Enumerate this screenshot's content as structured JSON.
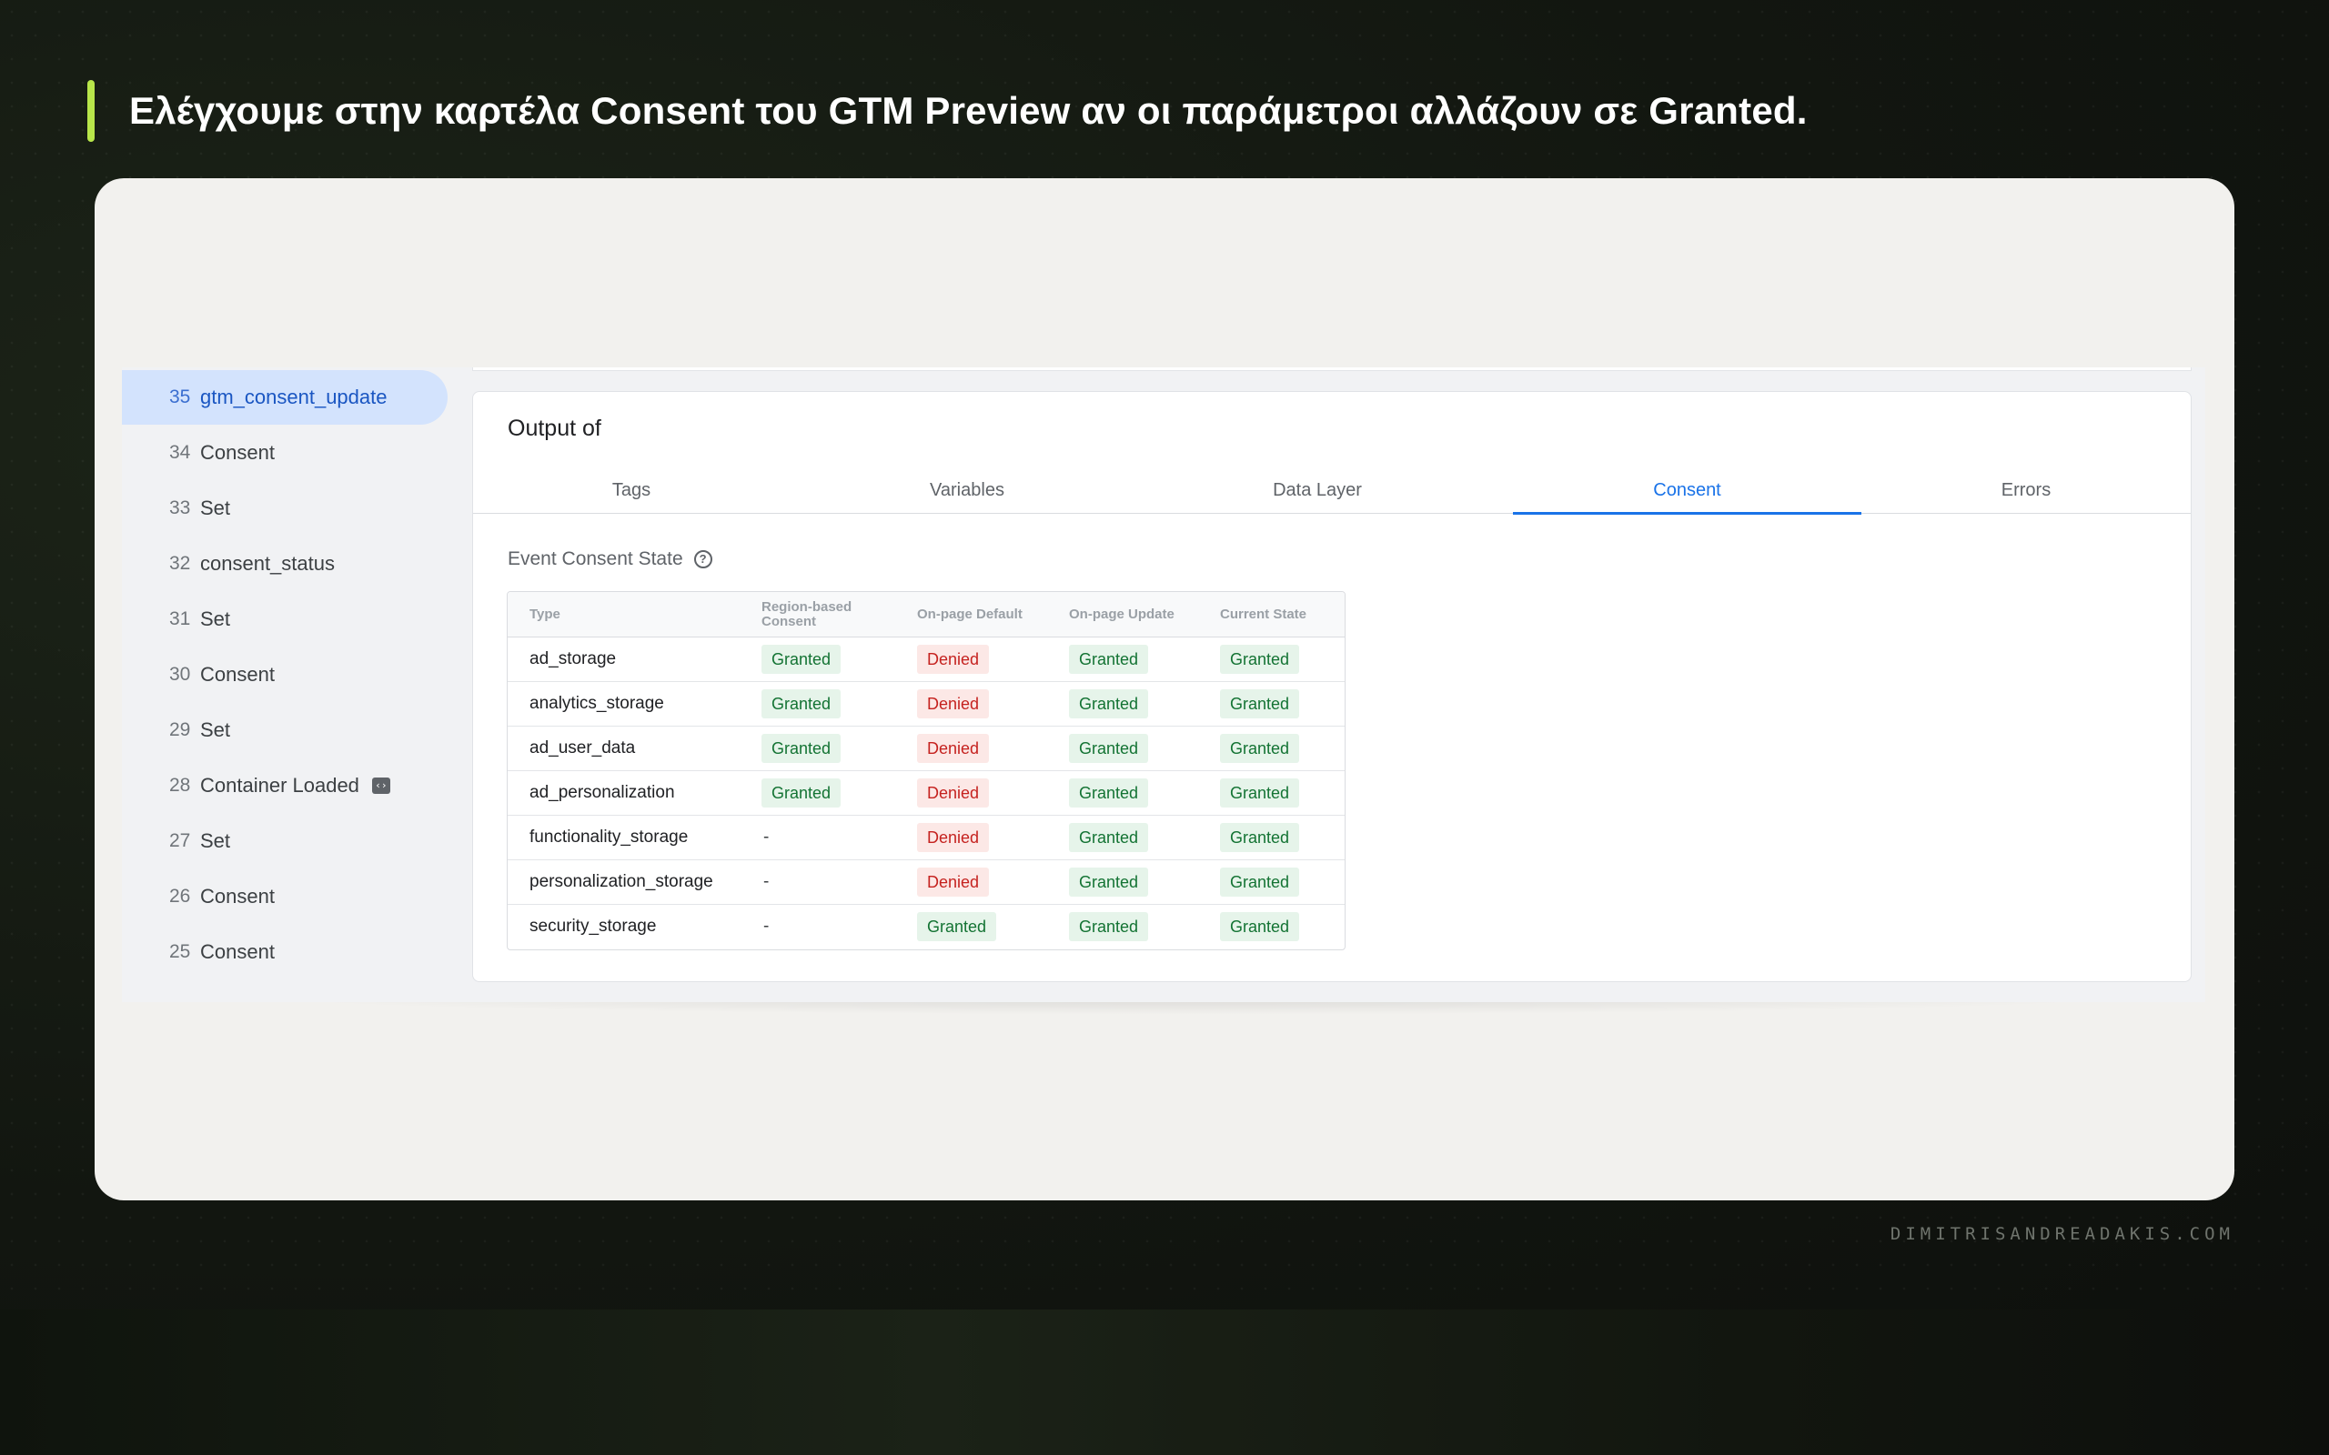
{
  "slide": {
    "headline": "Ελέγχουμε στην καρτέλα Consent του GTM Preview αν οι παράμετροι αλλάζουν σε Granted.",
    "footer": "DIMITRISANDREADAKIS.COM",
    "accent_color": "#b8e64a"
  },
  "sidebar": {
    "events": [
      {
        "num": "35",
        "label": "gtm_consent_update",
        "active": true
      },
      {
        "num": "34",
        "label": "Consent"
      },
      {
        "num": "33",
        "label": "Set"
      },
      {
        "num": "32",
        "label": "consent_status"
      },
      {
        "num": "31",
        "label": "Set"
      },
      {
        "num": "30",
        "label": "Consent"
      },
      {
        "num": "29",
        "label": "Set"
      },
      {
        "num": "28",
        "label": "Container Loaded",
        "icon": "container-icon"
      },
      {
        "num": "27",
        "label": "Set"
      },
      {
        "num": "26",
        "label": "Consent"
      },
      {
        "num": "25",
        "label": "Consent"
      }
    ]
  },
  "panel": {
    "title": "Output of",
    "tabs": [
      {
        "label": "Tags"
      },
      {
        "label": "Variables"
      },
      {
        "label": "Data Layer"
      },
      {
        "label": "Consent",
        "active": true
      },
      {
        "label": "Errors"
      }
    ],
    "active_color": "#1a73e8",
    "section_title": "Event Consent State",
    "section_icon": "help-circle-icon"
  },
  "consent_table": {
    "headers": {
      "type": "Type",
      "region_line1": "Region-based",
      "region_line2": "Consent",
      "default": "On-page Default",
      "update": "On-page Update",
      "current": "Current State"
    },
    "rows": [
      {
        "type": "ad_storage",
        "region": "Granted",
        "default": "Denied",
        "update": "Granted",
        "current": "Granted"
      },
      {
        "type": "analytics_storage",
        "region": "Granted",
        "default": "Denied",
        "update": "Granted",
        "current": "Granted"
      },
      {
        "type": "ad_user_data",
        "region": "Granted",
        "default": "Denied",
        "update": "Granted",
        "current": "Granted"
      },
      {
        "type": "ad_personalization",
        "region": "Granted",
        "default": "Denied",
        "update": "Granted",
        "current": "Granted"
      },
      {
        "type": "functionality_storage",
        "region": "-",
        "default": "Denied",
        "update": "Granted",
        "current": "Granted"
      },
      {
        "type": "personalization_storage",
        "region": "-",
        "default": "Denied",
        "update": "Granted",
        "current": "Granted"
      },
      {
        "type": "security_storage",
        "region": "-",
        "default": "Granted",
        "update": "Granted",
        "current": "Granted"
      }
    ],
    "granted_color": "#137333",
    "denied_color": "#c5221f"
  }
}
